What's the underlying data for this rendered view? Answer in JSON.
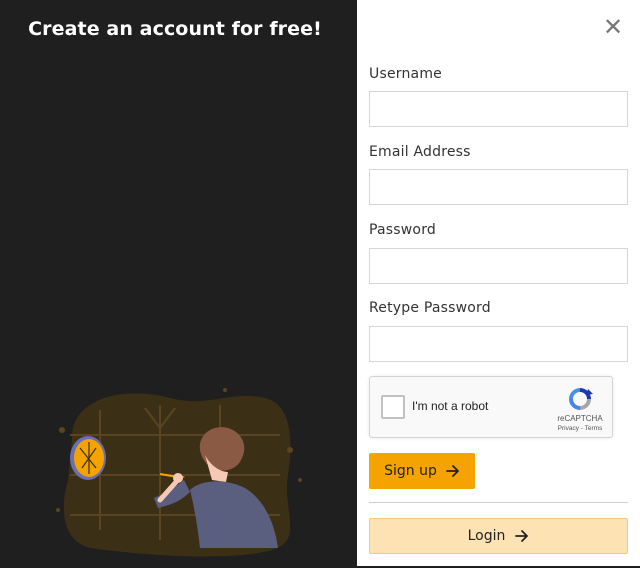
{
  "left": {
    "headline": "Create an account for free!"
  },
  "form": {
    "close_icon": "close-icon",
    "fields": [
      {
        "label": "Username",
        "value": "",
        "placeholder": ""
      },
      {
        "label": "Email Address",
        "value": "",
        "placeholder": ""
      },
      {
        "label": "Password",
        "value": "",
        "placeholder": ""
      },
      {
        "label": "Retype Password",
        "value": "",
        "placeholder": ""
      }
    ],
    "recaptcha": {
      "label": "I'm not a robot",
      "brand": "reCAPTCHA",
      "links": "Privacy - Terms"
    },
    "signup_label": "Sign up",
    "login_label": "Login"
  },
  "colors": {
    "accent": "#f5a300",
    "accent_light": "#fde2b4",
    "dark_bg": "#1f1f1f"
  }
}
